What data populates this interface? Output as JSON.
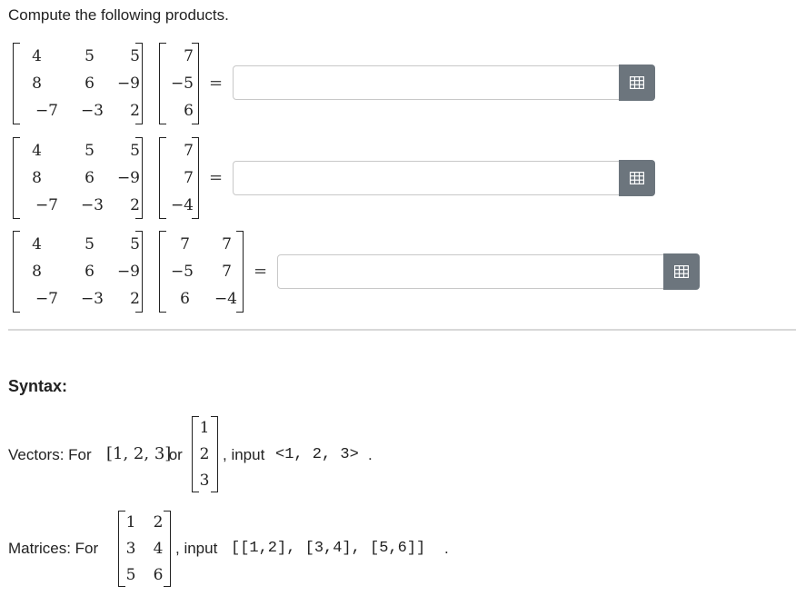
{
  "prompt": "Compute the following products.",
  "problems": [
    {
      "left": [
        [
          "4",
          "5",
          "5"
        ],
        [
          "8",
          "6",
          "−9"
        ],
        [
          "−7",
          "−3",
          "2"
        ]
      ],
      "right": [
        [
          "7"
        ],
        [
          "−5"
        ],
        [
          "6"
        ]
      ],
      "equals": "=",
      "answer_value": "",
      "button_icon": "grid-icon"
    },
    {
      "left": [
        [
          "4",
          "5",
          "5"
        ],
        [
          "8",
          "6",
          "−9"
        ],
        [
          "−7",
          "−3",
          "2"
        ]
      ],
      "right": [
        [
          "7"
        ],
        [
          "7"
        ],
        [
          "−4"
        ]
      ],
      "equals": "=",
      "answer_value": "",
      "button_icon": "grid-icon"
    },
    {
      "left": [
        [
          "4",
          "5",
          "5"
        ],
        [
          "8",
          "6",
          "−9"
        ],
        [
          "−7",
          "−3",
          "2"
        ]
      ],
      "right": [
        [
          "7",
          "7"
        ],
        [
          "−5",
          "7"
        ],
        [
          "6",
          "−4"
        ]
      ],
      "equals": "=",
      "answer_value": "",
      "button_icon": "grid-icon"
    }
  ],
  "syntax": {
    "heading": "Syntax:",
    "vectors": {
      "label": "Vectors: For ",
      "inline": "[1, 2, 3]",
      "or": " or ",
      "column": [
        [
          "1"
        ],
        [
          "2"
        ],
        [
          "3"
        ]
      ],
      "input_prefix": ", input ",
      "code": "<1, 2, 3>",
      "suffix": "."
    },
    "matrices": {
      "label": "Matrices: For ",
      "matrix": [
        [
          "1",
          "2"
        ],
        [
          "3",
          "4"
        ],
        [
          "5",
          "6"
        ]
      ],
      "input_prefix": ", input ",
      "code": "[[1,2], [3,4], [5,6]]",
      "suffix": "."
    }
  },
  "colors": {
    "button": "#6c757d",
    "border": "#c8c8c8",
    "divider": "#d8d8d8"
  }
}
